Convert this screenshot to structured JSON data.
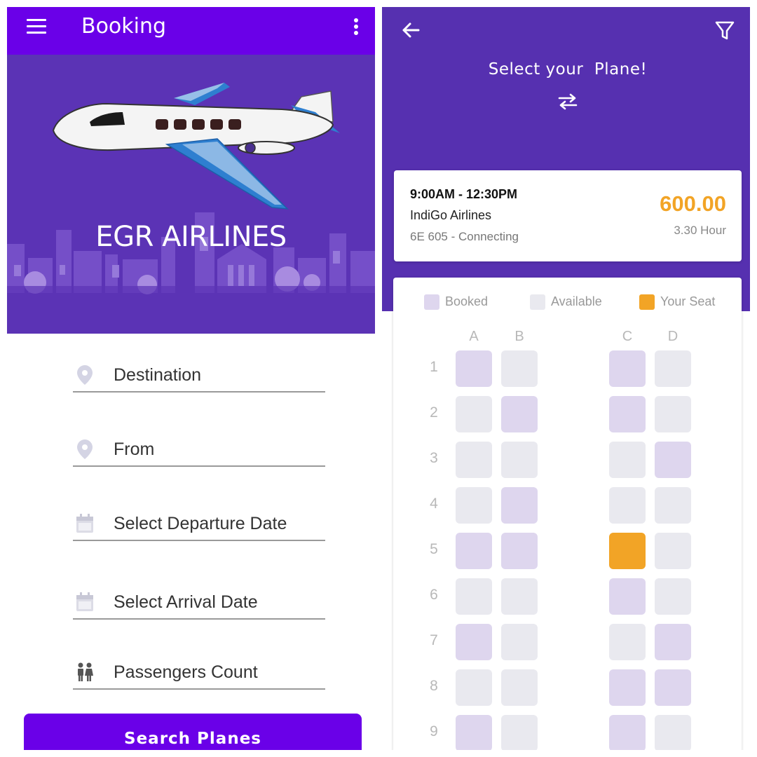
{
  "booking": {
    "header": {
      "title": "Booking"
    },
    "hero": {
      "airline_name": "EGR AIRLINES"
    },
    "fields": [
      {
        "label": "Destination",
        "icon": "location-pin-icon"
      },
      {
        "label": "From",
        "icon": "location-pin-icon"
      },
      {
        "label": "Select Departure Date",
        "icon": "calendar-icon"
      },
      {
        "label": "Select Arrival Date",
        "icon": "calendar-icon"
      },
      {
        "label": "Passengers Count",
        "icon": "people-icon"
      }
    ],
    "search_button": "Search Planes"
  },
  "select_plane": {
    "title": "Select your  Plane!",
    "flight": {
      "time": "9:00AM - 12:30PM",
      "airline": "IndiGo Airlines",
      "number": "6E 605 - Connecting",
      "price": "600.00",
      "duration": "3.30 Hour"
    },
    "legend": [
      {
        "label": "Booked",
        "status": "booked",
        "color": "#ded6ee"
      },
      {
        "label": "Available",
        "status": "available",
        "color": "#e9e9ef"
      },
      {
        "label": "Your Seat",
        "status": "mine",
        "color": "#f2a426"
      }
    ],
    "columns": [
      "A",
      "B",
      "C",
      "D"
    ],
    "rows": [
      {
        "number": "1",
        "seats": [
          "booked",
          "available",
          "booked",
          "available"
        ]
      },
      {
        "number": "2",
        "seats": [
          "available",
          "booked",
          "booked",
          "available"
        ]
      },
      {
        "number": "3",
        "seats": [
          "available",
          "available",
          "available",
          "booked"
        ]
      },
      {
        "number": "4",
        "seats": [
          "available",
          "booked",
          "available",
          "available"
        ]
      },
      {
        "number": "5",
        "seats": [
          "booked",
          "booked",
          "mine",
          "available"
        ]
      },
      {
        "number": "6",
        "seats": [
          "available",
          "available",
          "booked",
          "available"
        ]
      },
      {
        "number": "7",
        "seats": [
          "booked",
          "available",
          "available",
          "booked"
        ]
      },
      {
        "number": "8",
        "seats": [
          "available",
          "available",
          "booked",
          "booked"
        ]
      },
      {
        "number": "9",
        "seats": [
          "booked",
          "available",
          "booked",
          "available"
        ]
      }
    ]
  },
  "colors": {
    "appbar": "#6a00e8",
    "hero_bg": "#5b33b5",
    "select_bg": "#5630b0",
    "accent_orange": "#f2a426"
  }
}
